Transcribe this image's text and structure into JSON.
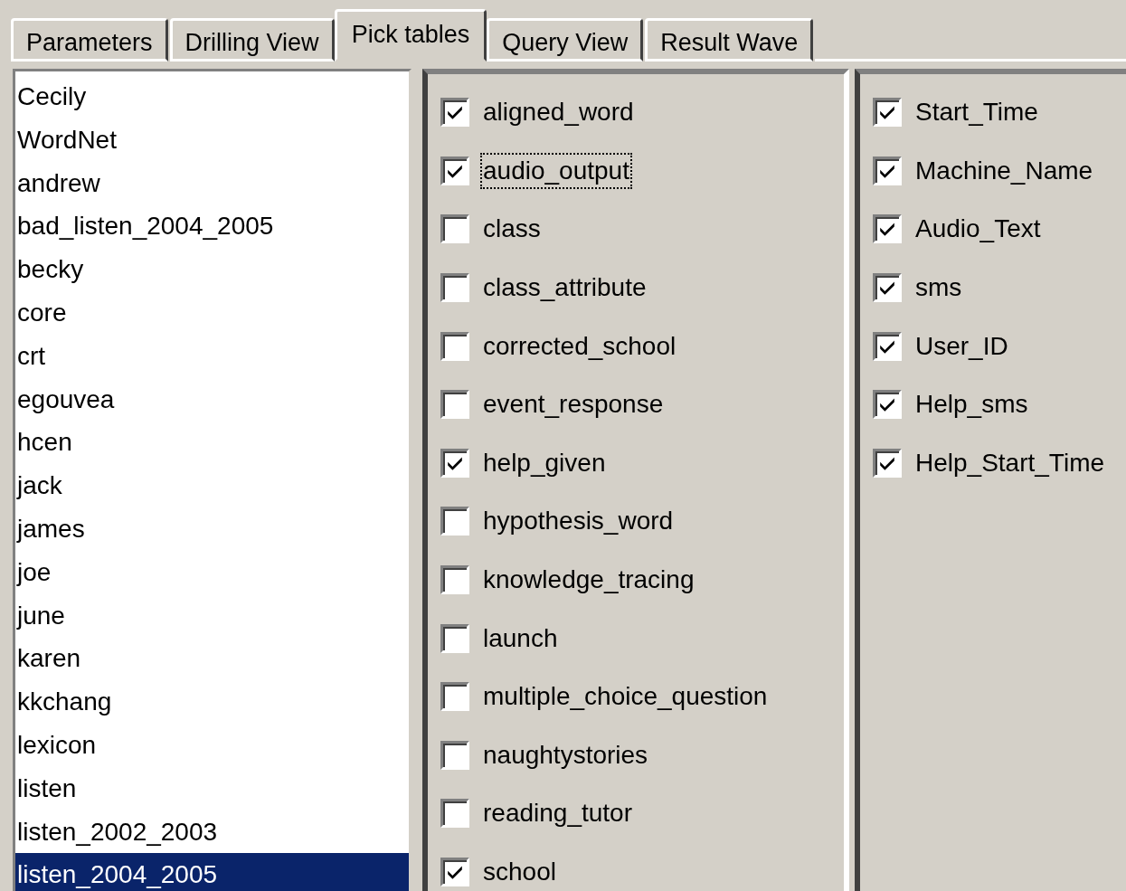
{
  "tabs": [
    {
      "label": "Parameters",
      "selected": false
    },
    {
      "label": "Drilling View",
      "selected": false
    },
    {
      "label": "Pick tables",
      "selected": true
    },
    {
      "label": "Query View",
      "selected": false
    },
    {
      "label": "Result Wave",
      "selected": false
    }
  ],
  "databases": {
    "items": [
      {
        "label": "Cecily",
        "selected": false
      },
      {
        "label": "WordNet",
        "selected": false
      },
      {
        "label": "andrew",
        "selected": false
      },
      {
        "label": "bad_listen_2004_2005",
        "selected": false
      },
      {
        "label": "becky",
        "selected": false
      },
      {
        "label": "core",
        "selected": false
      },
      {
        "label": "crt",
        "selected": false
      },
      {
        "label": "egouvea",
        "selected": false
      },
      {
        "label": "hcen",
        "selected": false
      },
      {
        "label": "jack",
        "selected": false
      },
      {
        "label": "james",
        "selected": false
      },
      {
        "label": "joe",
        "selected": false
      },
      {
        "label": "june",
        "selected": false
      },
      {
        "label": "karen",
        "selected": false
      },
      {
        "label": "kkchang",
        "selected": false
      },
      {
        "label": "lexicon",
        "selected": false
      },
      {
        "label": "listen",
        "selected": false
      },
      {
        "label": "listen_2002_2003",
        "selected": false
      },
      {
        "label": "listen_2004_2005",
        "selected": true
      }
    ]
  },
  "tables": {
    "items": [
      {
        "label": "aligned_word",
        "checked": true,
        "focused": false
      },
      {
        "label": "audio_output",
        "checked": true,
        "focused": true
      },
      {
        "label": "class",
        "checked": false,
        "focused": false
      },
      {
        "label": "class_attribute",
        "checked": false,
        "focused": false
      },
      {
        "label": "corrected_school",
        "checked": false,
        "focused": false
      },
      {
        "label": "event_response",
        "checked": false,
        "focused": false
      },
      {
        "label": "help_given",
        "checked": true,
        "focused": false
      },
      {
        "label": "hypothesis_word",
        "checked": false,
        "focused": false
      },
      {
        "label": "knowledge_tracing",
        "checked": false,
        "focused": false
      },
      {
        "label": "launch",
        "checked": false,
        "focused": false
      },
      {
        "label": "multiple_choice_question",
        "checked": false,
        "focused": false
      },
      {
        "label": "naughtystories",
        "checked": false,
        "focused": false
      },
      {
        "label": "reading_tutor",
        "checked": false,
        "focused": false
      },
      {
        "label": "school",
        "checked": true,
        "focused": false
      }
    ]
  },
  "columns": {
    "items": [
      {
        "label": "Start_Time",
        "checked": true
      },
      {
        "label": "Machine_Name",
        "checked": true
      },
      {
        "label": "Audio_Text",
        "checked": true
      },
      {
        "label": "sms",
        "checked": true
      },
      {
        "label": "User_ID",
        "checked": true
      },
      {
        "label": "Help_sms",
        "checked": true
      },
      {
        "label": "Help_Start_Time",
        "checked": true
      }
    ]
  }
}
